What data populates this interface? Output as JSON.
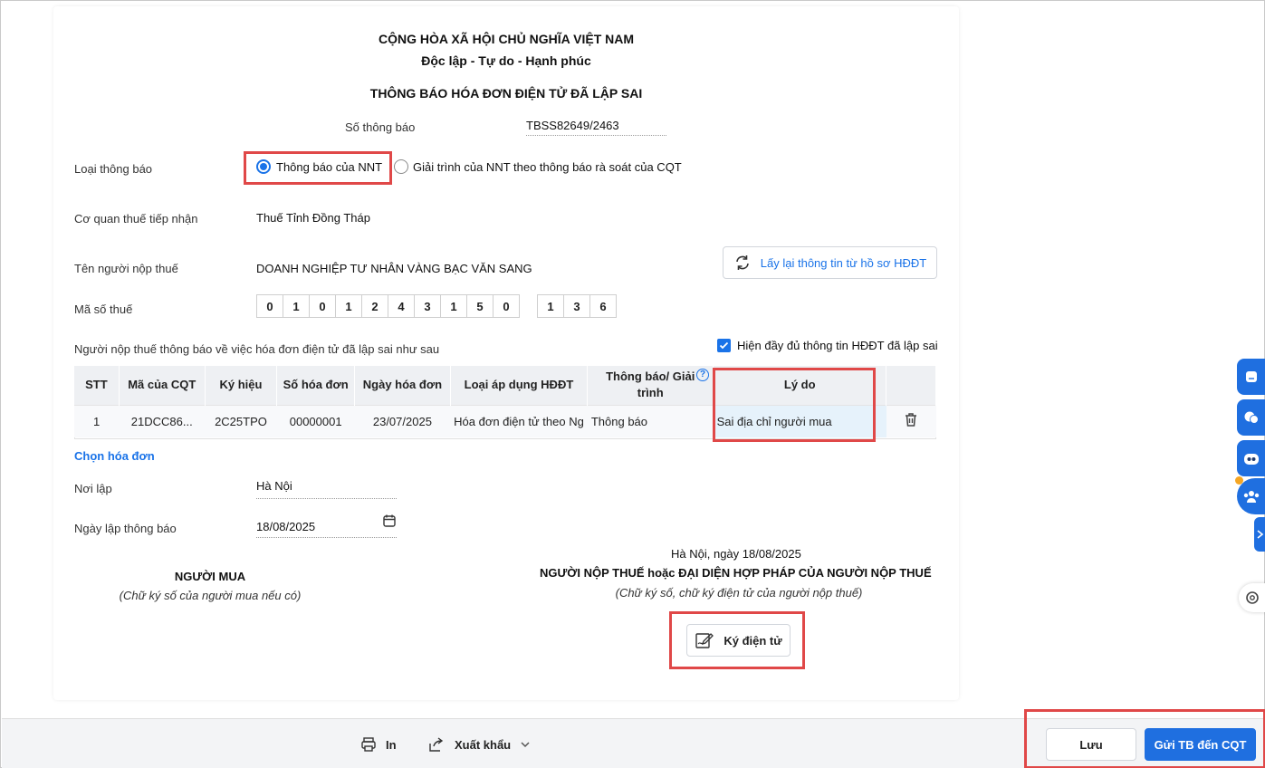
{
  "header": {
    "nation": "CỘNG HÒA XÃ HỘI CHỦ NGHĨA VIỆT NAM",
    "motto": "Độc lập - Tự do - Hạnh phúc",
    "doc_title": "THÔNG BÁO HÓA ĐƠN ĐIỆN TỬ ĐÃ LẬP SAI"
  },
  "notice_number": {
    "label": "Số thông báo",
    "value": "TBSS82649/2463"
  },
  "notice_type": {
    "label": "Loại thông báo",
    "options": [
      "Thông báo của NNT",
      "Giải trình của NNT theo thông báo rà soát của CQT"
    ],
    "selected": "Thông báo của NNT"
  },
  "tax_office": {
    "label": "Cơ quan thuế tiếp nhận",
    "value": "Thuế Tỉnh Đồng Tháp"
  },
  "taxpayer": {
    "label": "Tên người nộp thuế",
    "value": "DOANH NGHIỆP TƯ NHÂN VÀNG BẠC VĂN SANG"
  },
  "reload_button": {
    "label": "Lấy lại thông tin từ hồ sơ HĐĐT",
    "icon": "refresh-icon"
  },
  "tax_code": {
    "label": "Mã số thuế",
    "digits": [
      "0",
      "1",
      "0",
      "1",
      "2",
      "4",
      "3",
      "1",
      "5",
      "0"
    ],
    "branch": [
      "1",
      "3",
      "6"
    ]
  },
  "table_intro": "Người nộp thuế thông báo về việc hóa đơn điện tử đã lập sai như sau",
  "show_full_checkbox": {
    "label": "Hiện đầy đủ thông tin HĐĐT đã lập sai",
    "checked": true
  },
  "table": {
    "headers": [
      "STT",
      "Mã của CQT",
      "Ký hiệu",
      "Số hóa đơn",
      "Ngày hóa đơn",
      "Loại áp dụng HĐĐT",
      "Thông báo/ Giải trình",
      "Lý do"
    ],
    "rows": [
      [
        "1",
        "21DCC86...",
        "2C25TPO",
        "00000001",
        "23/07/2025",
        "Hóa đơn điện tử theo Ng",
        "Thông báo",
        "Sai địa chỉ người mua"
      ]
    ]
  },
  "choose_invoice_link": "Chọn hóa đơn",
  "place": {
    "label": "Nơi lập",
    "value": "Hà Nội"
  },
  "notice_date": {
    "label": "Ngày lập thông báo",
    "value": "18/08/2025"
  },
  "buyer": {
    "title": "NGƯỜI MUA",
    "note": "(Chữ ký số của người mua nếu có)"
  },
  "signer": {
    "date_line": "Hà Nội, ngày 18/08/2025",
    "title": "NGƯỜI NỘP THUẾ hoặc ĐẠI DIỆN HỢP PHÁP CỦA NGƯỜI NỘP THUẾ",
    "note": "(Chữ ký số, chữ ký điện tử của người nộp thuế)",
    "sign_button": "Ký điện tử"
  },
  "footer": {
    "print": "In",
    "export": "Xuất khẩu",
    "save": "Lưu",
    "send": "Gửi TB đến CQT"
  },
  "colors": {
    "accent": "#1a73e8",
    "highlight": "#e04848",
    "send_button": "#1f6fe0"
  }
}
